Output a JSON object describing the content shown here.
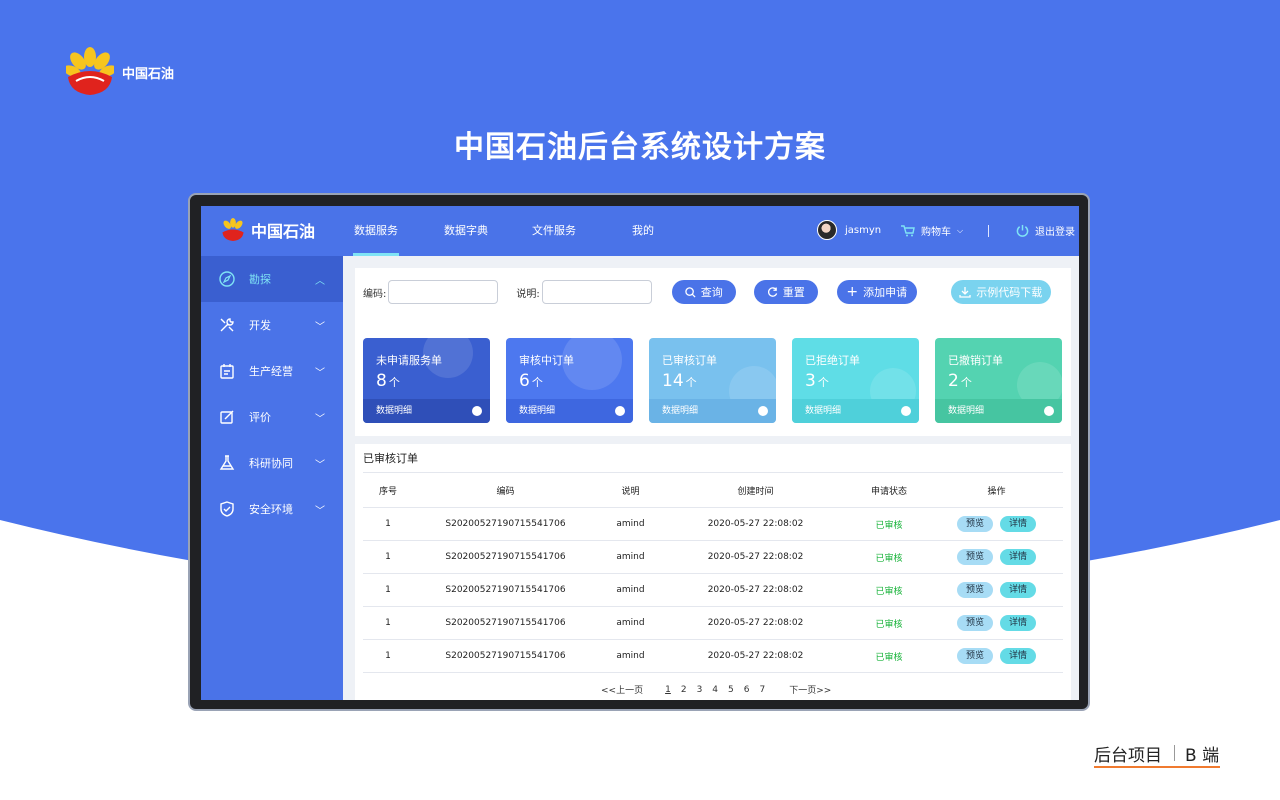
{
  "brand": {
    "name": "中国石油"
  },
  "hero": {
    "title": "中国石油后台系统设计方案"
  },
  "footer": {
    "left": "后台项目",
    "right": "B 端"
  },
  "colors": {
    "primary": "#4a73e8",
    "accent": "#7fe3f5",
    "success": "#18b33a",
    "footer_rule": "#f07a2f"
  },
  "app": {
    "logo_text": "中国石油",
    "nav": [
      {
        "label": "数据服务",
        "active": true
      },
      {
        "label": "数据字典"
      },
      {
        "label": "文件服务"
      },
      {
        "label": "我的"
      }
    ],
    "user": {
      "name": "jasmyn"
    },
    "cart": {
      "label": "购物车"
    },
    "logout": {
      "label": "退出登录"
    }
  },
  "sidebar": {
    "items": [
      {
        "label": "勘探",
        "icon": "compass-icon",
        "active": true
      },
      {
        "label": "开发",
        "icon": "tools-icon"
      },
      {
        "label": "生产经营",
        "icon": "clipboard-icon"
      },
      {
        "label": "评价",
        "icon": "edit-icon"
      },
      {
        "label": "科研协同",
        "icon": "flask-icon"
      },
      {
        "label": "安全环境",
        "icon": "shield-icon"
      }
    ]
  },
  "filter": {
    "code_label": "编码:",
    "code_value": "",
    "desc_label": "说明:",
    "desc_value": "",
    "query": "查询",
    "reset": "重置",
    "add": "添加申请",
    "download": "示例代码下载"
  },
  "cards": [
    {
      "title": "未申请服务单",
      "count": "8",
      "unit": "个",
      "footer": "数据明细",
      "color": "#3a5fd0"
    },
    {
      "title": "审核中订单",
      "count": "6",
      "unit": "个",
      "footer": "数据明细",
      "color": "#4d78ef"
    },
    {
      "title": "已审核订单",
      "count": "14",
      "unit": "个",
      "footer": "数据明细",
      "color": "#79c1ee"
    },
    {
      "title": "已拒绝订单",
      "count": "3",
      "unit": "个",
      "footer": "数据明细",
      "color": "#5fdde6"
    },
    {
      "title": "已撤销订单",
      "count": "2",
      "unit": "个",
      "footer": "数据明细",
      "color": "#54d3b1"
    }
  ],
  "table": {
    "title": "已审核订单",
    "columns": [
      "序号",
      "编码",
      "说明",
      "创建时间",
      "申请状态",
      "操作"
    ],
    "preview_label": "预览",
    "detail_label": "详情",
    "rows": [
      {
        "index": "1",
        "code": "S2020052719071554170​6",
        "desc": "amind",
        "created": "2020-05-27  22:08:02",
        "status": "已审核"
      },
      {
        "index": "1",
        "code": "S20200527190715541706",
        "desc": "amind",
        "created": "2020-05-27  22:08:02",
        "status": "已审核"
      },
      {
        "index": "1",
        "code": "S20200527190715541706",
        "desc": "amind",
        "created": "2020-05-27  22:08:02",
        "status": "已审核"
      },
      {
        "index": "1",
        "code": "S20200527190715541706",
        "desc": "amind",
        "created": "2020-05-27  22:08:02",
        "status": "已审核"
      },
      {
        "index": "1",
        "code": "S20200527190715541706",
        "desc": "amind",
        "created": "2020-05-27  22:08:02",
        "status": "已审核"
      }
    ]
  },
  "pager": {
    "prev": "<<上一页",
    "pages": [
      "1",
      "2",
      "3",
      "4",
      "5",
      "6",
      "7"
    ],
    "current": "1",
    "next": "下一页>>"
  }
}
